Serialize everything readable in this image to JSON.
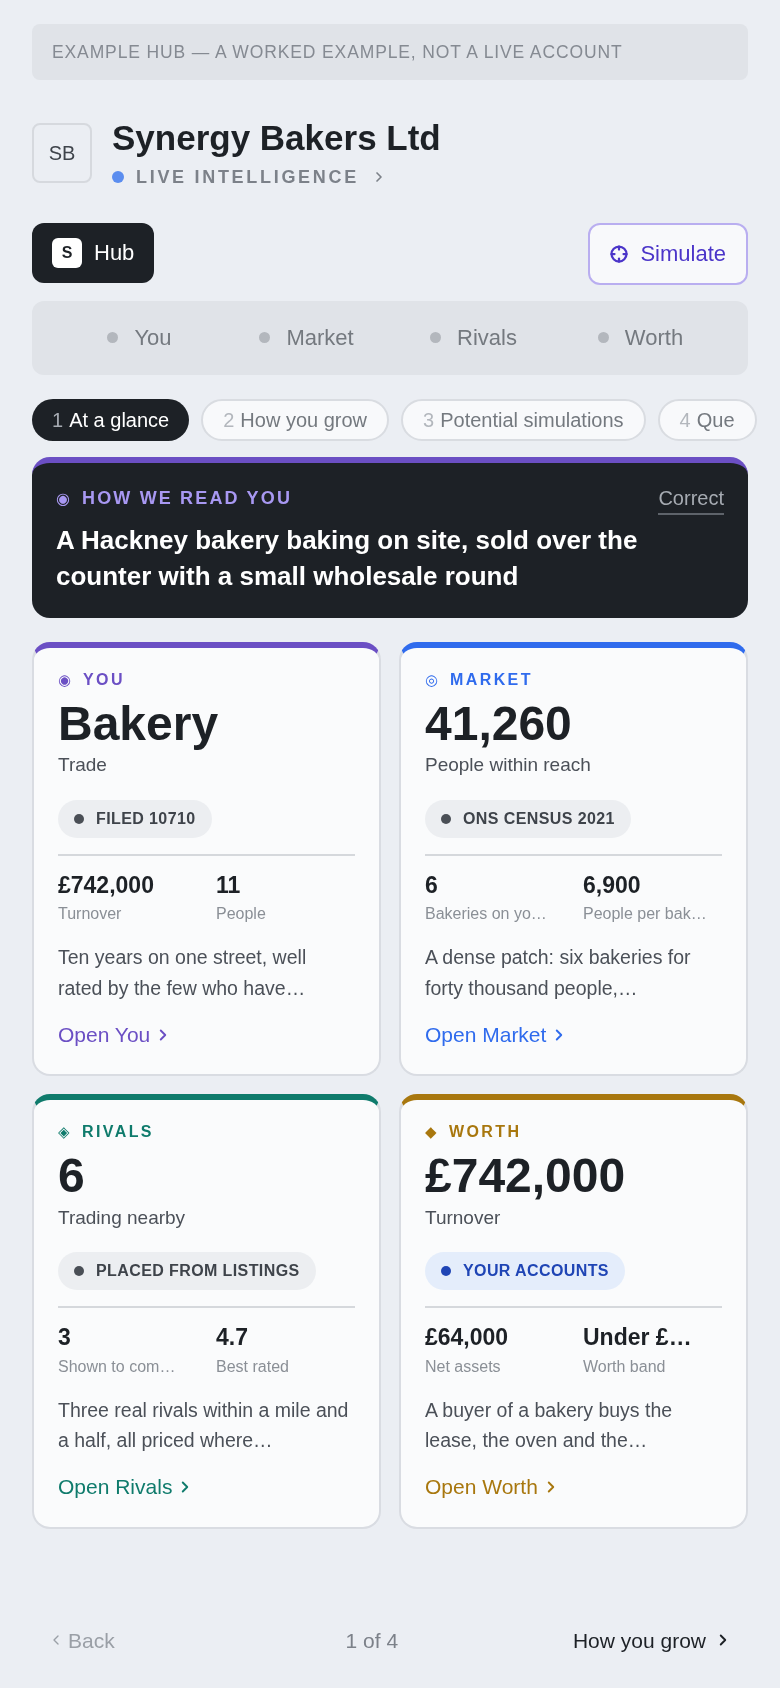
{
  "banner": "EXAMPLE HUB — A WORKED EXAMPLE, NOT A LIVE ACCOUNT",
  "header": {
    "initials": "SB",
    "title": "Synergy Bakers Ltd",
    "status": "LIVE INTELLIGENCE"
  },
  "actions": {
    "hub": {
      "logo": "S",
      "label": "Hub"
    },
    "simulate": {
      "label": "Simulate"
    }
  },
  "sections": [
    {
      "label": "You",
      "selected": false
    },
    {
      "label": "Market",
      "selected": false
    },
    {
      "label": "Rivals",
      "selected": false
    },
    {
      "label": "Worth",
      "selected": false
    }
  ],
  "steps": [
    {
      "number": "1",
      "label": "At a glance",
      "selected": true
    },
    {
      "number": "2",
      "label": "How you grow",
      "selected": false
    },
    {
      "number": "3",
      "label": "Potential simulations",
      "selected": false
    },
    {
      "number": "4",
      "label": "Que",
      "selected": false
    }
  ],
  "reading": {
    "icon": "◉",
    "eyebrow": "HOW WE READ YOU",
    "action": "Correct",
    "summary": "A Hackney bakery baking on site, sold over the counter with a small wholesale round"
  },
  "cards": [
    {
      "color": "#6b4fc4",
      "icon": "◉",
      "eyebrow": "YOU",
      "value": "Bakery",
      "caption": "Trade",
      "badge": {
        "label": "FILED 10710",
        "kind": "neutral"
      },
      "stats": [
        {
          "value": "£742,000",
          "label": "Turnover"
        },
        {
          "value": "11",
          "label": "People"
        }
      ],
      "text": "Ten years on one street, well rated by the few who have…",
      "link": "Open You"
    },
    {
      "color": "#2f6bed",
      "icon": "◎",
      "eyebrow": "MARKET",
      "value": "41,260",
      "caption": "People within reach",
      "badge": {
        "label": "ONS CENSUS 2021",
        "kind": "neutral"
      },
      "stats": [
        {
          "value": "6",
          "label": "Bakeries on yo…"
        },
        {
          "value": "6,900",
          "label": "People per bak…"
        }
      ],
      "text": "A dense patch: six bakeries for forty thousand people,…",
      "link": "Open Market"
    },
    {
      "color": "#0f7b6c",
      "icon": "◈",
      "eyebrow": "RIVALS",
      "value": "6",
      "caption": "Trading nearby",
      "badge": {
        "label": "PLACED FROM LISTINGS",
        "kind": "neutral"
      },
      "stats": [
        {
          "value": "3",
          "label": "Shown to com…"
        },
        {
          "value": "4.7",
          "label": "Best rated"
        }
      ],
      "text": "Three real rivals within a mile and a half, all priced where…",
      "link": "Open Rivals"
    },
    {
      "color": "#a8770e",
      "icon": "◆",
      "eyebrow": "WORTH",
      "value": "£742,000",
      "caption": "Turnover",
      "badge": {
        "label": "YOUR ACCOUNTS",
        "kind": "accent"
      },
      "stats": [
        {
          "value": "£64,000",
          "label": "Net assets"
        },
        {
          "value": "Under £…",
          "label": "Worth band"
        }
      ],
      "text": "A buyer of a bakery buys the lease, the oven and the…",
      "link": "Open Worth"
    }
  ],
  "footer": {
    "back": {
      "label": "Back",
      "disabled": true
    },
    "page": "1 of 4",
    "next": {
      "label": "How you grow"
    }
  }
}
